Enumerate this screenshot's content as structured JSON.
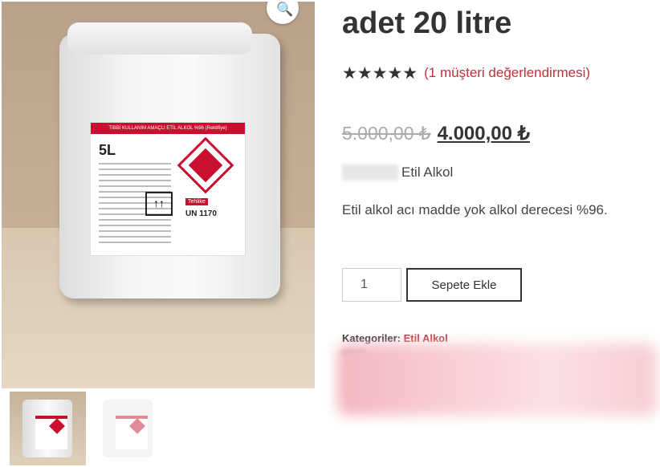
{
  "product": {
    "title": "adet 20 litre",
    "rating_stars": 5,
    "stars_glyph": "★★★★★",
    "review_link": "(1 müşteri değerlendirmesi)",
    "old_price": "5.000,00 ₺",
    "new_price": "4.000,00 ₺",
    "brand": "Etil Alkol",
    "description": "Etil alkol acı madde yok alkol derecesi %96.",
    "quantity": "1",
    "add_to_cart_label": "Sepete Ekle",
    "categories_label": "Kategoriler:",
    "category": "Etil Alkol"
  },
  "image": {
    "label_band": "TIBBİ KULLANIM AMAÇLI ETİL ALKOL %96 (Rektifiye)",
    "size": "5L",
    "hazard": "Tehlike",
    "un_code": "UN 1170",
    "arrows": "↑↑",
    "zoom_icon": "🔍"
  },
  "colors": {
    "accent": "#c0303a",
    "text": "#333333"
  }
}
